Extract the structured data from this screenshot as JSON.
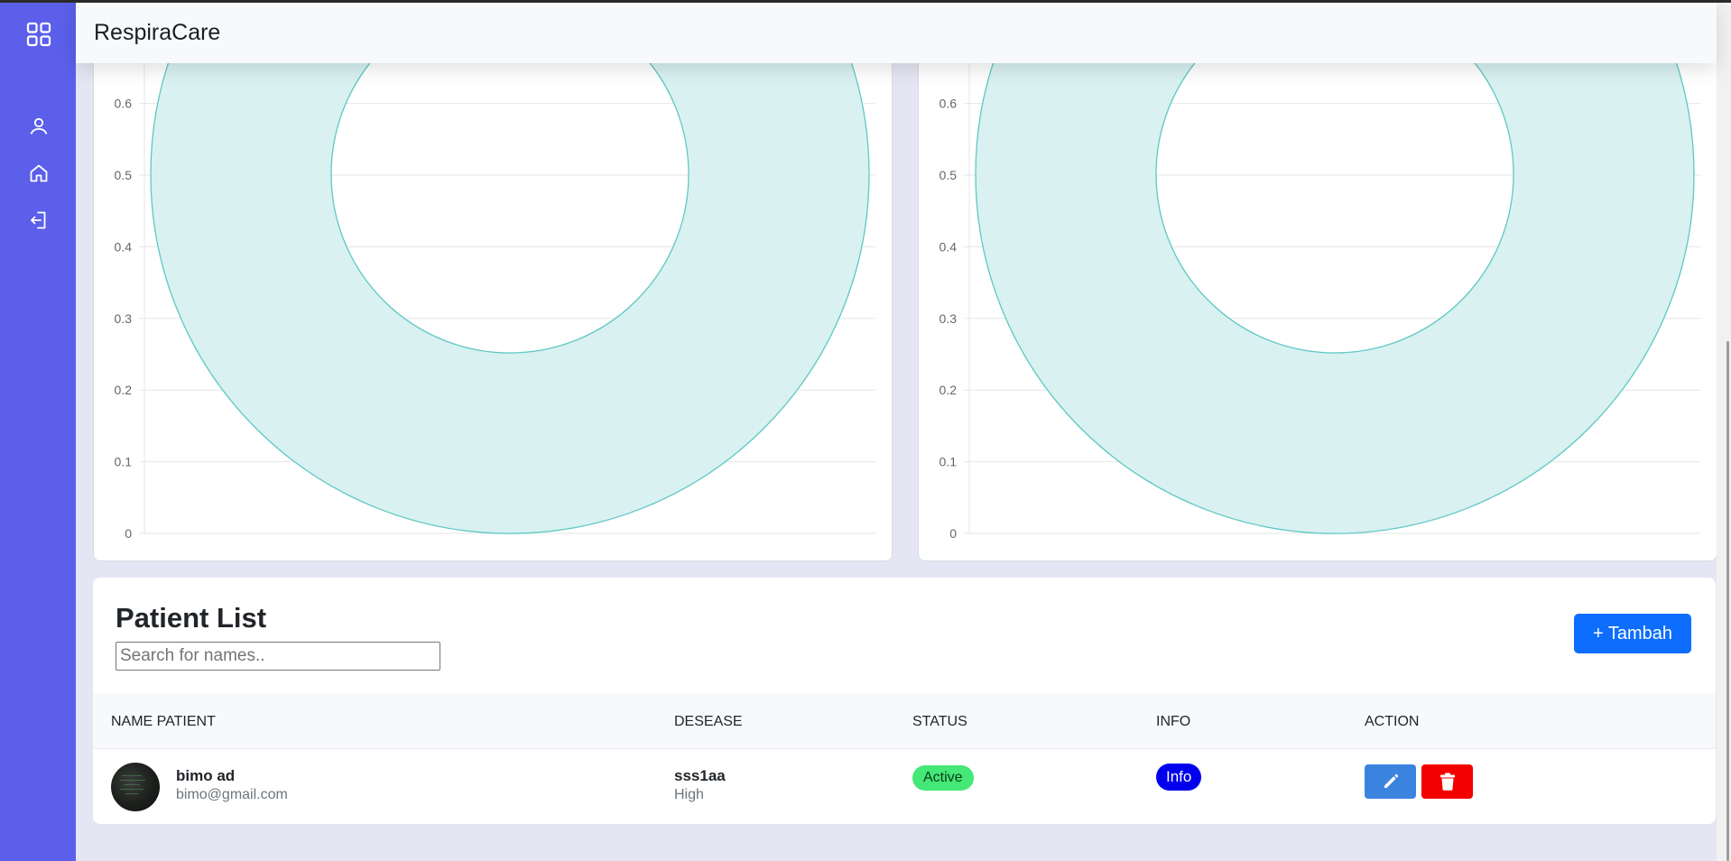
{
  "app": {
    "brand": "RespiraCare"
  },
  "sidebar": {
    "items": [
      {
        "icon": "grid-icon"
      },
      {
        "icon": "user-icon"
      },
      {
        "icon": "home-icon"
      },
      {
        "icon": "logout-icon"
      }
    ]
  },
  "colors": {
    "sidebar": "#5b5fea",
    "chart_fill": "#d9f1f1",
    "chart_stroke": "#5fc8c4",
    "primary": "#0d6efd",
    "danger": "#f20000",
    "active": "#44e876",
    "info": "#0000ee"
  },
  "chart_data": [
    {
      "type": "pie",
      "variant": "doughnut",
      "title": "",
      "y_ticks": [
        "0",
        "0.1",
        "0.2",
        "0.3",
        "0.4",
        "0.5",
        "0.6"
      ],
      "ylim": [
        0,
        0.7
      ],
      "grid": true,
      "slices": [
        {
          "label": "",
          "value": 1
        }
      ]
    },
    {
      "type": "pie",
      "variant": "doughnut",
      "title": "",
      "y_ticks": [
        "0",
        "0.1",
        "0.2",
        "0.3",
        "0.4",
        "0.5",
        "0.6"
      ],
      "ylim": [
        0,
        0.7
      ],
      "grid": true,
      "slices": [
        {
          "label": "",
          "value": 1
        }
      ]
    }
  ],
  "patients": {
    "title": "Patient List",
    "search_placeholder": "Search for names..",
    "add_label": "+ Tambah",
    "columns": [
      "NAME PATIENT",
      "DESEASE",
      "STATUS",
      "INFO",
      "ACTION"
    ],
    "rows": [
      {
        "name": "bimo ad",
        "email": "bimo@gmail.com",
        "disease": "sss1aa",
        "level": "High",
        "status": "Active",
        "info": "Info"
      }
    ]
  }
}
